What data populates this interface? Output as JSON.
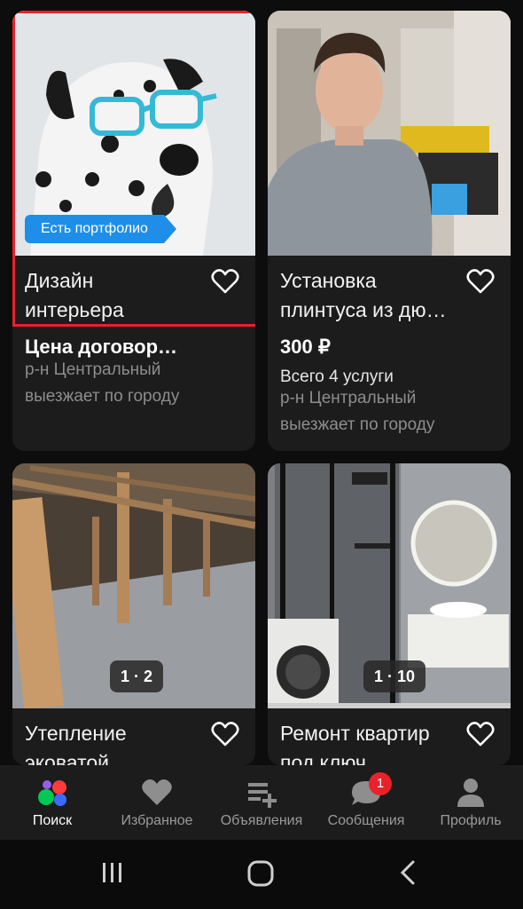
{
  "listings": [
    {
      "title_line1": "Дизайн",
      "title_line2": "интерьера",
      "price": "Цена договор…",
      "location_line1": "р-н Центральный",
      "location_line2": "выезжает по городу",
      "badge": "Есть портфолио"
    },
    {
      "title_line1": "Установка",
      "title_line2": "плинтуса из дю…",
      "price": "300 ₽",
      "services": "Всего 4 услуги",
      "location_line1": "р-н Центральный",
      "location_line2": "выезжает по городу"
    },
    {
      "title_line1": "Утепление",
      "title_line2": "эковатой",
      "photo_counter": "1 · 2"
    },
    {
      "title_line1": "Ремонт квартир",
      "title_line2": "под ключ",
      "photo_counter": "1 · 10"
    }
  ],
  "tabs": [
    {
      "label": "Поиск",
      "icon": "search-dots-icon",
      "active": true
    },
    {
      "label": "Избранное",
      "icon": "heart-icon"
    },
    {
      "label": "Объявления",
      "icon": "listings-add-icon"
    },
    {
      "label": "Сообщения",
      "icon": "chat-bubble-icon",
      "badge": "1"
    },
    {
      "label": "Профиль",
      "icon": "person-icon"
    }
  ],
  "colors": {
    "background": "#0d0d0d",
    "card": "#1c1c1c",
    "badge": "#1e8ee8",
    "highlight": "#e8222b",
    "notification": "#e8222b"
  }
}
